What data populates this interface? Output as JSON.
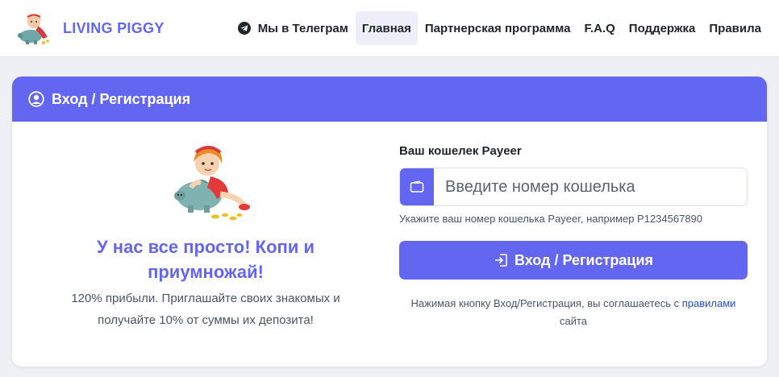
{
  "brand": {
    "name": "LIVING PIGGY",
    "logo_icon": "piggy-girl-logo"
  },
  "nav": {
    "telegram_icon": "telegram-icon",
    "items": [
      {
        "label": "Мы в Телеграм",
        "active": false
      },
      {
        "label": "Главная",
        "active": true
      },
      {
        "label": "Партнерская программа",
        "active": false
      },
      {
        "label": "F.A.Q",
        "active": false
      },
      {
        "label": "Поддержка",
        "active": false
      },
      {
        "label": "Правила",
        "active": false
      }
    ]
  },
  "card": {
    "icon": "user-circle-icon",
    "title": "Вход / Регистрация",
    "hero_image": "girl-with-piggy-bank",
    "slogan": "У нас все просто! Копи и приумножай!",
    "description": "120% прибыли. Приглашайте своих знакомых и получайте 10% от суммы их депозита!",
    "form": {
      "label": "Ваш кошелек Payeer",
      "wallet_icon": "wallet-icon",
      "value": "",
      "placeholder": "Введите номер кошелька",
      "hint": "Укажите ваш номер кошелька Payeer, например P1234567890",
      "button_icon": "sign-in-icon",
      "button_label": "Вход / Регистрация",
      "agree_prefix": "Нажимая кнопку Вход/Регистрация, вы соглашаетесь с ",
      "agree_link": "правилами",
      "agree_suffix": " сайта"
    }
  },
  "colors": {
    "accent": "#6366f1",
    "link": "#1d4ed8",
    "page_bg": "#eef0f5"
  }
}
